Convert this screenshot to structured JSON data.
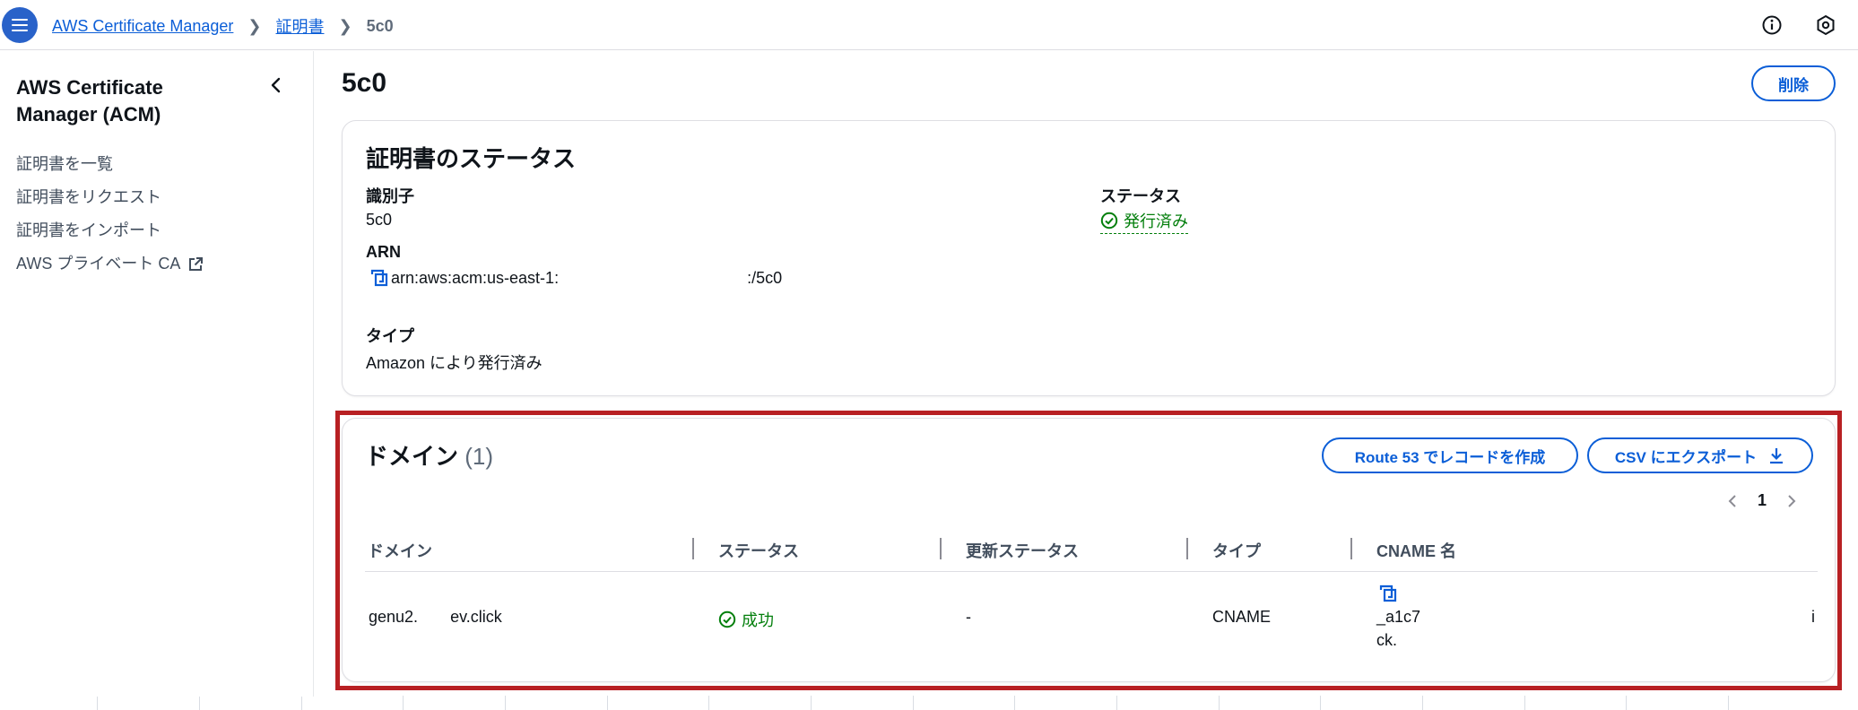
{
  "topnav": {
    "breadcrumb": [
      "AWS Certificate Manager",
      "証明書",
      "5c0"
    ],
    "icons": [
      "menu-icon",
      "info-icon",
      "settings-icon"
    ]
  },
  "sidebar": {
    "title": "AWS Certificate Manager (ACM)",
    "items": [
      {
        "label": "証明書を一覧"
      },
      {
        "label": "証明書をリクエスト"
      },
      {
        "label": "証明書をインポート"
      },
      {
        "label": "AWS プライベート CA",
        "external": true
      }
    ]
  },
  "page": {
    "title": "5c0",
    "delete_label": "削除"
  },
  "status_panel": {
    "heading": "証明書のステータス",
    "identifier_label": "識別子",
    "identifier_value": "5c0",
    "status_label": "ステータス",
    "status_value": "発行済み",
    "arn_label": "ARN",
    "arn_value_start": "arn:aws:acm:us-east-1:",
    "arn_value_end": ":/5c0",
    "type_label": "タイプ",
    "type_value": "Amazon により発行済み"
  },
  "domain_panel": {
    "heading": "ドメイン",
    "count": "(1)",
    "route53_label": "Route 53 でレコードを作成",
    "export_label": "CSV にエクスポート",
    "page_number": "1",
    "columns": [
      "ドメイン",
      "ステータス",
      "更新ステータス",
      "タイプ",
      "CNAME 名"
    ],
    "rows": [
      {
        "domain": "genu2.",
        "domain_suffix": "ev.click",
        "status": "成功",
        "renewal_status": "-",
        "type": "CNAME",
        "cname_line1": "_a1c7",
        "cname_line2": "ck.",
        "trailing": "i"
      }
    ]
  },
  "colors": {
    "accent": "#0b5ed7",
    "menu_button": "#2962c9",
    "success": "#037f0c",
    "highlight": "#b82023"
  }
}
